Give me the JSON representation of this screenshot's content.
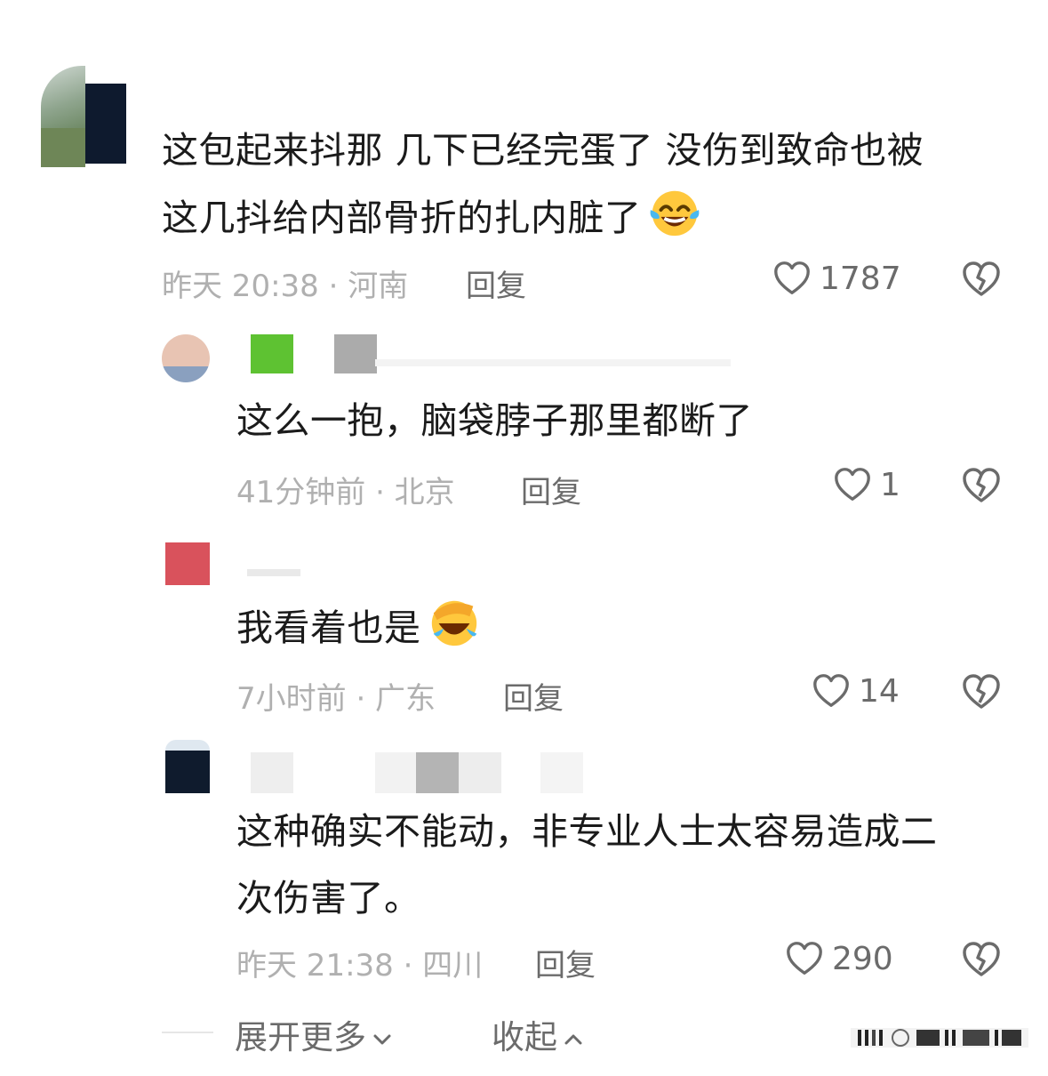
{
  "comments": [
    {
      "text_line1": "这包起来抖那 几下已经完蛋了   没伤到致命也被",
      "text_line2": "这几抖给内部骨折的扎内脏了",
      "meta": "昨天 20:38 · 河南",
      "reply_label": "回复",
      "like_count": "1787",
      "emoji": "joy-tears-emoji"
    },
    {
      "text_line1": "这么一抱，脑袋脖子那里都断了",
      "meta": "41分钟前 · 北京",
      "reply_label": "回复",
      "like_count": "1"
    },
    {
      "text_line1": "我看着也是",
      "meta": "7小时前 · 广东",
      "reply_label": "回复",
      "like_count": "14",
      "emoji": "facepalm-crying-emoji"
    },
    {
      "text_line1": "这种确实不能动，非专业人士太容易造成二",
      "text_line2": "次伤害了。",
      "meta": "昨天 21:38 · 四川",
      "reply_label": "回复",
      "like_count": "290"
    }
  ],
  "footer": {
    "expand_label": "展开更多",
    "collapse_label": "收起"
  },
  "icons": {
    "like": "heart-outline-icon",
    "dislike": "broken-heart-icon",
    "expand": "chevron-down-icon",
    "collapse": "chevron-up-icon"
  },
  "colors": {
    "text": "#1b1b1b",
    "meta": "#b0b0b0",
    "action": "#6b6b6b"
  }
}
